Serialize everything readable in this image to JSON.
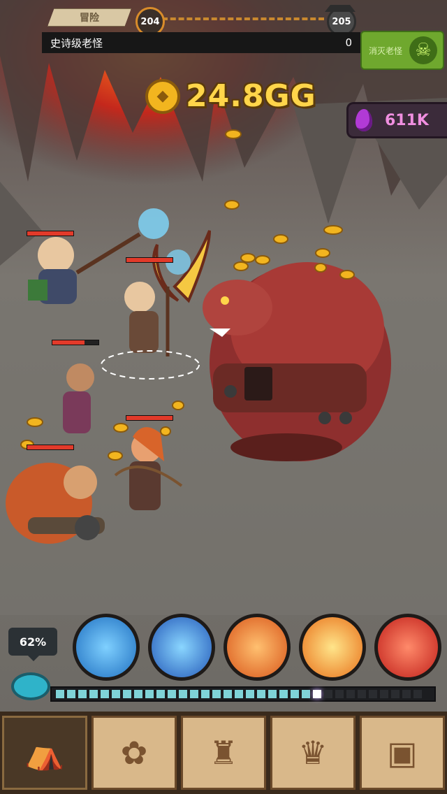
{
  "top": {
    "stage_label": "冒险",
    "current_level": "204",
    "next_level": "205"
  },
  "boss_bar": {
    "title": "史诗级老怪",
    "count": "0"
  },
  "kill_boss": {
    "label": "消灭老怪"
  },
  "currency": {
    "gold": "24.8GG",
    "gems": "611K"
  },
  "skills": {
    "charge_percent": "62%",
    "energy_fill": 0.69,
    "items": [
      {
        "name": "blade-storm",
        "color": "#2f8fe0"
      },
      {
        "name": "shield-bash",
        "color": "#3a7fe6"
      },
      {
        "name": "arrow-volley",
        "color": "#f0782a"
      },
      {
        "name": "fire-burst",
        "color": "#f0912a"
      },
      {
        "name": "rage-strike",
        "color": "#e0322a"
      }
    ]
  },
  "nav": {
    "items": [
      "camp",
      "relics",
      "heroes",
      "cauldron",
      "vault"
    ]
  },
  "colors": {
    "accent_gold": "#ffd54a",
    "gem_purple": "#b13ad6",
    "hp_red": "#e23a2a"
  }
}
